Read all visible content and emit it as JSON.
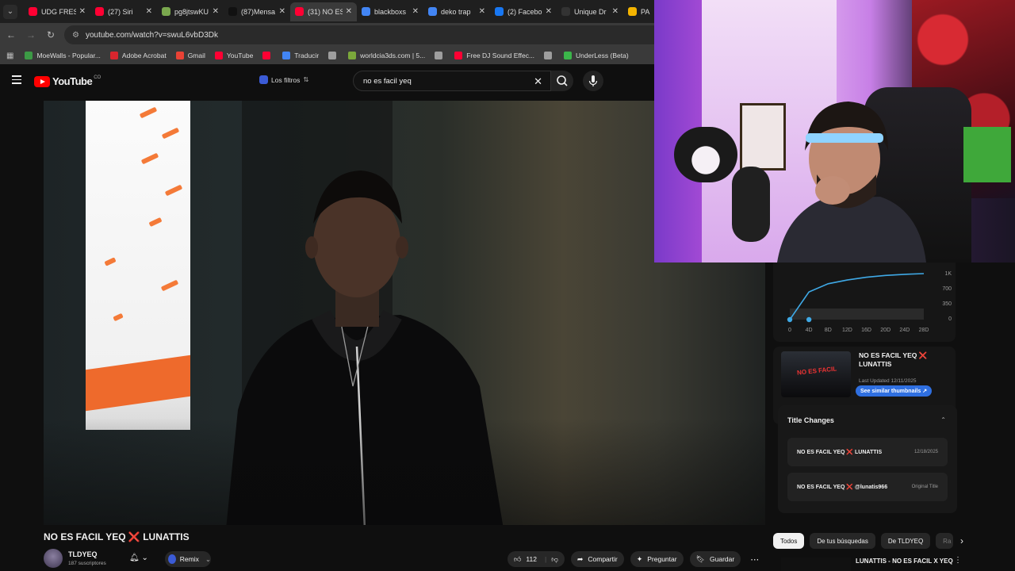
{
  "browser": {
    "tabs": [
      {
        "title": "UDG FRES",
        "fav": "#ff0033",
        "active": false
      },
      {
        "title": "(27) Siri",
        "fav": "#ff0033",
        "active": false
      },
      {
        "title": "pg8jtswKU",
        "fav": "#7aa84e",
        "active": false
      },
      {
        "title": "(87)Mensa",
        "fav": "#111111",
        "active": false
      },
      {
        "title": "(31) NO ES",
        "fav": "#ff0033",
        "active": true
      },
      {
        "title": "blackboxs",
        "fav": "#4285f4",
        "active": false
      },
      {
        "title": "deko trap",
        "fav": "#4285f4",
        "active": false
      },
      {
        "title": "(2) Facebo",
        "fav": "#1877f2",
        "active": false
      },
      {
        "title": "Unique Dr",
        "fav": "#333333",
        "active": false
      },
      {
        "title": "PA",
        "fav": "#f4b400",
        "active": false
      }
    ],
    "url": "youtube.com/watch?v=swuL6vbD3Dk",
    "bookmarks": [
      {
        "label": "MoeWalls - Popular...",
        "color": "#3c9a45"
      },
      {
        "label": "Adobe Acrobat",
        "color": "#d7262e"
      },
      {
        "label": "Gmail",
        "color": "#e94235"
      },
      {
        "label": "YouTube",
        "color": "#ff0033"
      },
      {
        "label": "",
        "color": "#ff0033"
      },
      {
        "label": "Traducir",
        "color": "#4285f4"
      },
      {
        "label": "",
        "color": "#9e9e9e"
      },
      {
        "label": "worldcia3ds.com | 5...",
        "color": "#7ba83b"
      },
      {
        "label": "",
        "color": "#9e9e9e"
      },
      {
        "label": "Free DJ Sound Effec...",
        "color": "#ff0033"
      },
      {
        "label": "",
        "color": "#9e9e9e"
      },
      {
        "label": "UnderLess (Beta)",
        "color": "#3bb54a"
      }
    ]
  },
  "youtube": {
    "logo_text": "YouTube",
    "logo_country": "CO",
    "filters_label": "Los filtros",
    "search_value": "no es facil yeq"
  },
  "video": {
    "title": "NO ES FACIL YEQ ❌ LUNATTIS",
    "channel": "TLDYEQ",
    "subscribers": "187 suscriptores",
    "remix_label": "Remix",
    "likes": "112",
    "share_label": "Compartir",
    "ask_label": "Preguntar",
    "save_label": "Guardar"
  },
  "side": {
    "chart_ticks_y": [
      "1K",
      "700",
      "350",
      "0"
    ],
    "chart_ticks_x": [
      "0",
      "4D",
      "8D",
      "12D",
      "16D",
      "20D",
      "24D",
      "28D"
    ],
    "thumb_title": "NO ES FACIL YEQ ❌ LUNATTIS",
    "thumb_overlay_text": "NO ES FACIL",
    "thumb_updated": "Last Updated 12/11/2025",
    "similar_btn": "See similar thumbnails ↗",
    "title_changes_header": "Title Changes",
    "title_changes": [
      {
        "title": "NO ES FACIL YEQ ❌ LUNATTIS",
        "date": "12/18/2025"
      },
      {
        "title": "NO ES FACIL YEQ ❌ @lunatis966",
        "date": "Original Title"
      }
    ],
    "chips": [
      "Todos",
      "De tus búsquedas",
      "De TLDYEQ",
      "Ra"
    ],
    "next_video_title": "LUNATTIS - NO ES FACIL X YEQ"
  },
  "colors": {
    "accent_blue": "#2f6fe0",
    "yt_red": "#ff0000",
    "bg": "#0f0f0f"
  },
  "chart_data": {
    "type": "line",
    "x": [
      "0",
      "4D",
      "8D",
      "12D",
      "16D",
      "20D",
      "24D",
      "28D"
    ],
    "series": [
      {
        "values": [
          0,
          600,
          780,
          860,
          920,
          960,
          985,
          1000
        ]
      }
    ],
    "ylim": [
      0,
      1000
    ],
    "grid": false
  }
}
